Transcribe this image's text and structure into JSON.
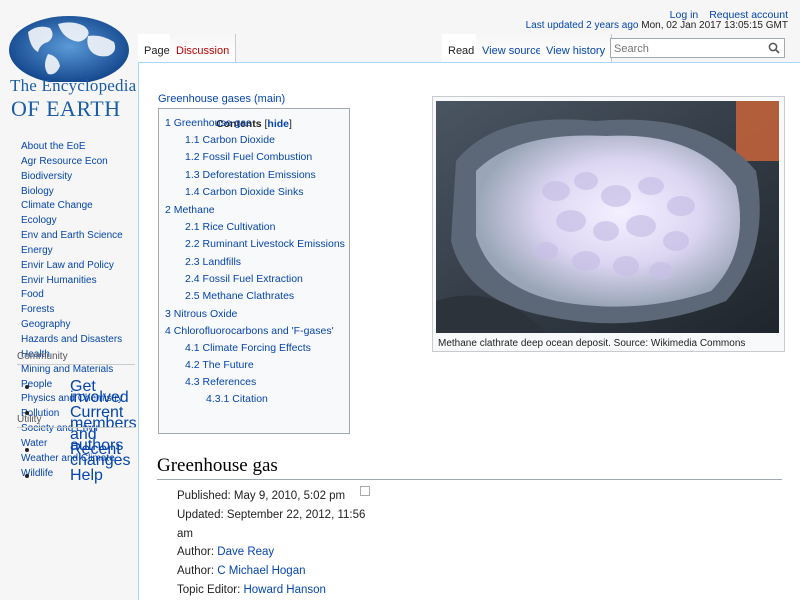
{
  "logo": {
    "line1": "The Encyclopedia",
    "line2": "OF EARTH"
  },
  "personal": {
    "login": "Log in",
    "request": "Request account"
  },
  "updated": {
    "label": "Last updated 2 years ago",
    "date": "Mon, 02 Jan 2017 13:05:15 GMT"
  },
  "tabs": {
    "page": "Page",
    "discussion": "Discussion",
    "read": "Read",
    "view_source": "View source",
    "view_history": "View history"
  },
  "search": {
    "placeholder": "Search"
  },
  "nav": {
    "items": [
      "About the EoE",
      "Agr Resource Econ",
      "Biodiversity",
      "Biology",
      "Climate Change",
      "Ecology",
      "Env and Earth Science",
      "Energy",
      "Envir Law and Policy",
      "Envir Humanities",
      "Food",
      "Forests",
      "Geography",
      "Hazards and Disasters",
      "Health",
      "Mining and Materials",
      "People",
      "Physics and Chemistry",
      "Pollution",
      "Society and Envir",
      "Water",
      "Weather and Climate",
      "Wildlife"
    ]
  },
  "community": {
    "title": "Community",
    "items": [
      "Get involved",
      "Current members and authors"
    ]
  },
  "utility": {
    "title": "Utility",
    "items": [
      "Recent changes",
      "Help"
    ]
  },
  "main_link": "Greenhouse gases (main)",
  "toc": {
    "title": "Contents",
    "hide_open": "[",
    "hide": "hide",
    "hide_close": "]",
    "items": [
      {
        "num": "1",
        "text": "Greenhouse gas",
        "level": 1
      },
      {
        "num": "1.1",
        "text": "Carbon Dioxide",
        "level": 2
      },
      {
        "num": "1.2",
        "text": "Fossil Fuel Combustion",
        "level": 2
      },
      {
        "num": "1.3",
        "text": "Deforestation Emissions",
        "level": 2
      },
      {
        "num": "1.4",
        "text": "Carbon Dioxide Sinks",
        "level": 2
      },
      {
        "num": "2",
        "text": "Methane",
        "level": 1
      },
      {
        "num": "2.1",
        "text": "Rice Cultivation",
        "level": 2
      },
      {
        "num": "2.2",
        "text": "Ruminant Livestock Emissions",
        "level": 2
      },
      {
        "num": "2.3",
        "text": "Landfills",
        "level": 2
      },
      {
        "num": "2.4",
        "text": "Fossil Fuel Extraction",
        "level": 2
      },
      {
        "num": "2.5",
        "text": "Methane Clathrates",
        "level": 2
      },
      {
        "num": "3",
        "text": "Nitrous Oxide",
        "level": 1
      },
      {
        "num": "4",
        "text": "Chlorofluorocarbons and 'F-gases'",
        "level": 1
      },
      {
        "num": "4.1",
        "text": "Climate Forcing Effects",
        "level": 2
      },
      {
        "num": "4.2",
        "text": "The Future",
        "level": 2
      },
      {
        "num": "4.3",
        "text": "References",
        "level": 2
      },
      {
        "num": "4.3.1",
        "text": "Citation",
        "level": 3
      }
    ]
  },
  "figure": {
    "caption": "Methane clathrate deep ocean deposit. Source: Wikimedia Commons"
  },
  "article": {
    "heading": "Greenhouse gas",
    "published": "Published: May 9, 2010, 5:02 pm",
    "updated": "Updated: September 22, 2012, 11:56 am",
    "author_label": "Author:",
    "author1": "Dave Reay",
    "author2": "C Michael Hogan",
    "topic_editor_label": "Topic Editor:",
    "topic_editor": "Howard Hanson"
  }
}
